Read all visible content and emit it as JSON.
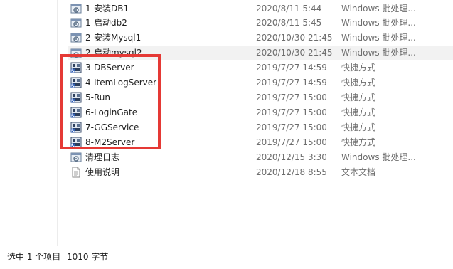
{
  "file_list": {
    "rows": [
      {
        "name": "1-安装DB1",
        "date": "2020/8/11 5:44",
        "type": "Windows 批处理...",
        "icon": "batch-file-icon"
      },
      {
        "name": "1-启动db2",
        "date": "2020/8/11 5:45",
        "type": "Windows 批处理...",
        "icon": "batch-file-icon"
      },
      {
        "name": "2-安装Mysql1",
        "date": "2020/10/30 21:45",
        "type": "Windows 批处理...",
        "icon": "batch-file-icon"
      },
      {
        "name": "2-启动mysql2",
        "date": "2020/10/30 21:45",
        "type": "Windows 批处理...",
        "icon": "batch-file-icon"
      },
      {
        "name": "3-DBServer",
        "date": "2019/7/27 14:59",
        "type": "快捷方式",
        "icon": "shortcut-icon"
      },
      {
        "name": "4-ItemLogServer",
        "date": "2019/7/27 14:59",
        "type": "快捷方式",
        "icon": "shortcut-icon"
      },
      {
        "name": "5-Run",
        "date": "2019/7/27 15:00",
        "type": "快捷方式",
        "icon": "shortcut-icon"
      },
      {
        "name": "6-LoginGate",
        "date": "2019/7/27 15:00",
        "type": "快捷方式",
        "icon": "shortcut-icon"
      },
      {
        "name": "7-GGService",
        "date": "2019/7/27 15:00",
        "type": "快捷方式",
        "icon": "shortcut-icon"
      },
      {
        "name": "8-M2Server",
        "date": "2019/7/27 15:00",
        "type": "快捷方式",
        "icon": "shortcut-icon"
      },
      {
        "name": "清理日志",
        "date": "2020/12/15 3:30",
        "type": "Windows 批处理...",
        "icon": "batch-file-icon"
      },
      {
        "name": "使用说明",
        "date": "2020/12/18 8:55",
        "type": "文本文档",
        "icon": "text-document-icon"
      }
    ]
  },
  "status_bar": {
    "selected": "选中 1 个项目",
    "size": "1010 字节"
  },
  "colors": {
    "annotation": "#e53935",
    "selected_row": "#f2f2f2"
  }
}
